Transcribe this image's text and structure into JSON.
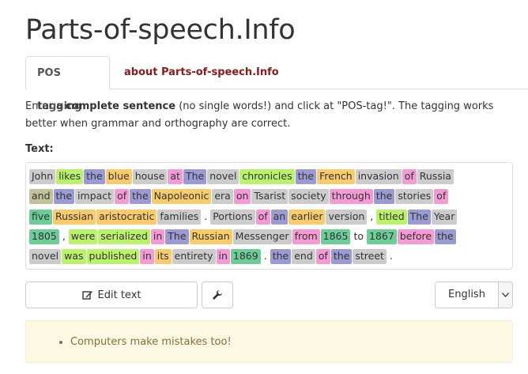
{
  "site_title": "Parts-of-speech.Info",
  "tabs": [
    {
      "label": "POS tagging"
    },
    {
      "label": "about Parts-of-speech.Info"
    }
  ],
  "instructions": {
    "pre": "Enter a ",
    "bold": "complete sentence",
    "post": " (no single words!) and click at \"POS-tag!\". The tagging works better when grammar and orthography are correct."
  },
  "text_label": "Text:",
  "tagged_lines": [
    [
      [
        "John",
        "nn"
      ],
      [
        "likes",
        "vb"
      ],
      [
        "the",
        "dt"
      ],
      [
        "blue",
        "jj"
      ],
      [
        "house",
        "nn"
      ],
      [
        "at",
        "in"
      ],
      [
        "The",
        "dt"
      ],
      [
        "novel",
        "nn"
      ],
      [
        "chronicles",
        "vb"
      ],
      [
        "the",
        "dt"
      ],
      [
        "French",
        "jj"
      ],
      [
        "invasion",
        "nn"
      ],
      [
        "of",
        "in"
      ],
      [
        "Russia",
        "nn"
      ]
    ],
    [
      [
        "and",
        "cc"
      ],
      [
        "the",
        "dt"
      ],
      [
        "impact",
        "nn"
      ],
      [
        "of",
        "in"
      ],
      [
        "the",
        "dt"
      ],
      [
        "Napoleonic",
        "jj"
      ],
      [
        "era",
        "nn"
      ],
      [
        "on",
        "in"
      ],
      [
        "Tsarist",
        "nn"
      ],
      [
        "society",
        "nn"
      ],
      [
        "through",
        "in"
      ],
      [
        "the",
        "dt"
      ],
      [
        "stories",
        "nn"
      ],
      [
        "of",
        "in"
      ]
    ],
    [
      [
        "five",
        "cd"
      ],
      [
        "Russian",
        "jj"
      ],
      [
        "aristocratic",
        "jj"
      ],
      [
        "families",
        "nn"
      ],
      [
        ".",
        "pu"
      ],
      [
        "Portions",
        "nn"
      ],
      [
        "of",
        "in"
      ],
      [
        "an",
        "dt"
      ],
      [
        "earlier",
        "jj"
      ],
      [
        "version",
        "nn"
      ],
      [
        ",",
        "pu"
      ],
      [
        "titled",
        "vb"
      ],
      [
        "The",
        "dt"
      ],
      [
        "Year",
        "nn"
      ]
    ],
    [
      [
        "1805",
        "cd"
      ],
      [
        ",",
        "pu"
      ],
      [
        "were",
        "vb"
      ],
      [
        "serialized",
        "vb"
      ],
      [
        "in",
        "in"
      ],
      [
        "The",
        "dt"
      ],
      [
        "Russian",
        "jj"
      ],
      [
        "Messenger",
        "nn"
      ],
      [
        "from",
        "in"
      ],
      [
        "1865",
        "cd"
      ],
      [
        "to",
        "pu"
      ],
      [
        "1867",
        "cd"
      ],
      [
        "before",
        "in"
      ],
      [
        "the",
        "dt"
      ]
    ],
    [
      [
        "novel",
        "nn"
      ],
      [
        "was",
        "vb"
      ],
      [
        "published",
        "vb"
      ],
      [
        "in",
        "in"
      ],
      [
        "its",
        "jj"
      ],
      [
        "entirety",
        "nn"
      ],
      [
        "in",
        "in"
      ],
      [
        "1869",
        "cd"
      ],
      [
        ".",
        "pu"
      ],
      [
        "the",
        "dt"
      ],
      [
        "end",
        "nn"
      ],
      [
        "of",
        "in"
      ],
      [
        "the",
        "dt"
      ],
      [
        "street",
        "nn"
      ],
      [
        ".",
        "pu"
      ]
    ]
  ],
  "buttons": {
    "edit_label": "Edit text"
  },
  "language": {
    "selected": "English"
  },
  "note": {
    "items": [
      "Computers make mistakes too!"
    ]
  },
  "colors": {
    "link": "#8b1a1a",
    "note_text": "#8a6d3b",
    "note_bg": "#fcf8e3"
  }
}
